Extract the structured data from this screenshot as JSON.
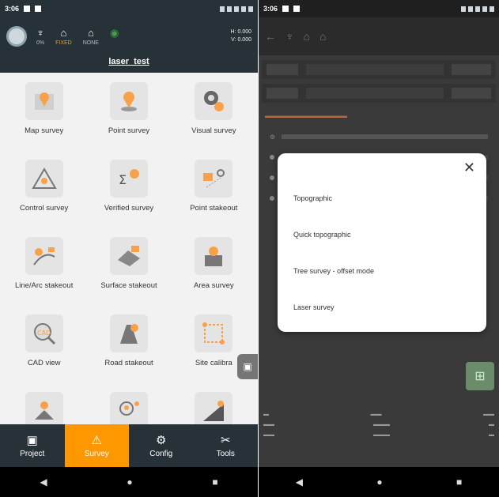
{
  "left": {
    "status": {
      "time": "3:06"
    },
    "appbar": {
      "stats": [
        {
          "icon": "satellite-icon",
          "glyph": "♆",
          "label": "0%"
        },
        {
          "icon": "base-icon",
          "glyph": "⌂",
          "label": "FIXED",
          "orange": true
        },
        {
          "icon": "rover-icon",
          "glyph": "⌂",
          "label": "NONE"
        },
        {
          "icon": "signal-icon",
          "glyph": "◉",
          "label": "",
          "green": true
        }
      ],
      "coords": [
        "H: 0.000",
        "V: 0.000"
      ],
      "project_name": "laser_test"
    },
    "tiles": [
      {
        "name": "map-survey",
        "label": "Map survey",
        "icon": "map-survey-icon"
      },
      {
        "name": "point-survey",
        "label": "Point survey",
        "icon": "point-survey-icon"
      },
      {
        "name": "visual-survey",
        "label": "Visual survey",
        "icon": "visual-survey-icon"
      },
      {
        "name": "control-survey",
        "label": "Control survey",
        "icon": "control-survey-icon"
      },
      {
        "name": "verified-survey",
        "label": "Verified survey",
        "icon": "verified-survey-icon"
      },
      {
        "name": "point-stakeout",
        "label": "Point stakeout",
        "icon": "point-stakeout-icon"
      },
      {
        "name": "line-arc-stakeout",
        "label": "Line/Arc stakeout",
        "icon": "line-arc-stakeout-icon"
      },
      {
        "name": "surface-stakeout",
        "label": "Surface stakeout",
        "icon": "surface-stakeout-icon"
      },
      {
        "name": "area-survey",
        "label": "Area survey",
        "icon": "area-survey-icon"
      },
      {
        "name": "cad-view",
        "label": "CAD view",
        "icon": "cad-view-icon"
      },
      {
        "name": "road-stakeout",
        "label": "Road stakeout",
        "icon": "road-stakeout-icon"
      },
      {
        "name": "site-calibration",
        "label": "Site calibra",
        "icon": "site-calibration-icon"
      },
      {
        "name": "tile-13",
        "label": "",
        "icon": "localization-icon"
      },
      {
        "name": "tile-14",
        "label": "",
        "icon": "point-search-icon"
      },
      {
        "name": "tile-15",
        "label": "",
        "icon": "slope-icon"
      }
    ],
    "bottomnav": [
      {
        "name": "project",
        "label": "Project",
        "glyph": "▣",
        "active": false
      },
      {
        "name": "survey",
        "label": "Survey",
        "glyph": "⚠",
        "active": true
      },
      {
        "name": "config",
        "label": "Config",
        "glyph": "⚙",
        "active": false
      },
      {
        "name": "tools",
        "label": "Tools",
        "glyph": "✂",
        "active": false
      }
    ]
  },
  "right": {
    "status": {
      "time": "3:06"
    },
    "dialog": {
      "options": [
        "Topographic",
        "Quick topographic",
        "Tree survey - offset mode",
        "Laser survey"
      ]
    }
  },
  "colors": {
    "appbar": "#263238",
    "accent": "#ff9800",
    "icon_orange": "#f7a24a"
  }
}
